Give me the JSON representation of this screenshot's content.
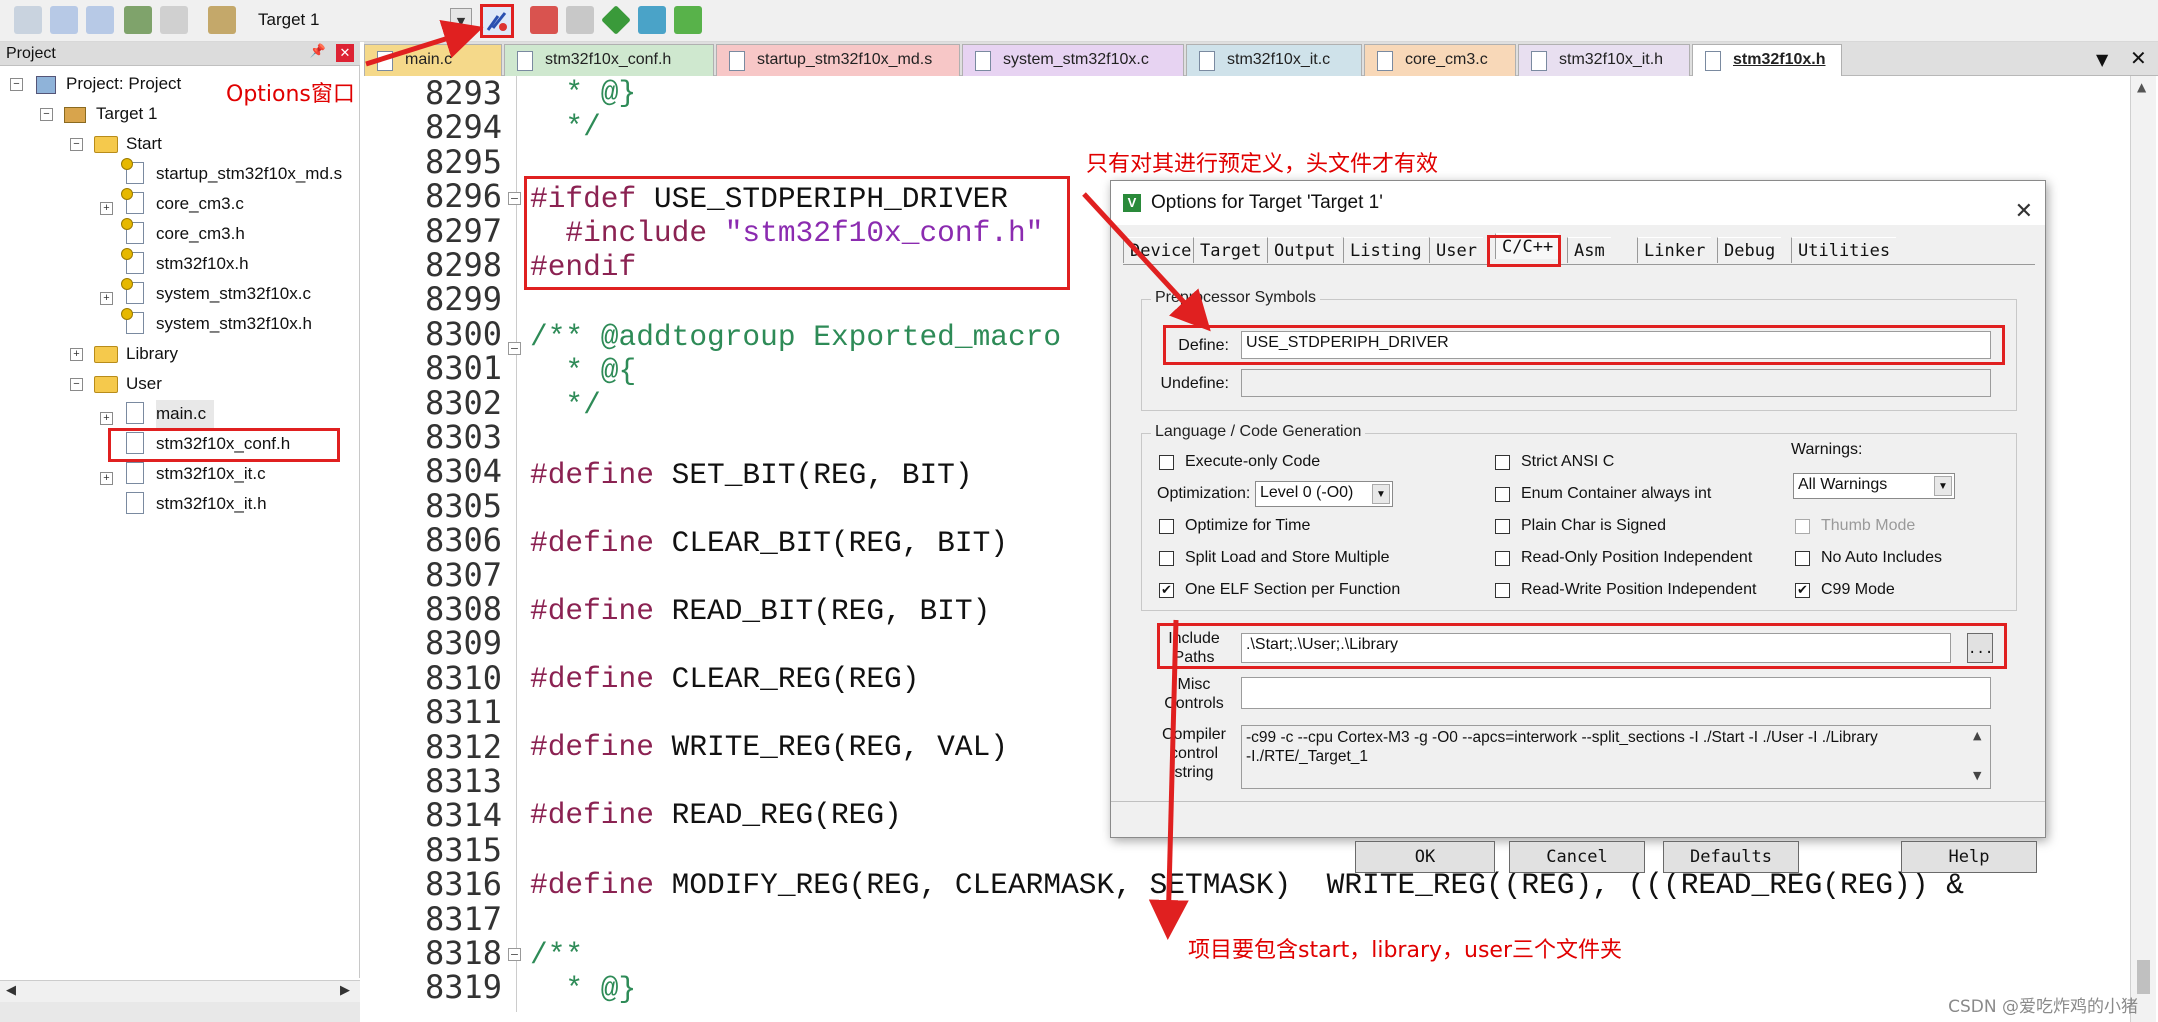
{
  "toolbar": {
    "target": "Target 1",
    "icons": [
      "translate-icon",
      "build-icon",
      "rebuild-icon",
      "batch-build-icon",
      "stop-build-icon",
      "download-icon",
      "options-for-target-icon",
      "manage-project-items-icon",
      "select-packs-icon",
      "manage-run-time-icon",
      "pack-installer-icon",
      "device-database-icon"
    ]
  },
  "project_panel": {
    "title": "Project",
    "tree": {
      "root": "Project: Project",
      "target": "Target 1",
      "start_group": "Start",
      "start_files": [
        "startup_stm32f10x_md.s",
        "core_cm3.c",
        "core_cm3.h",
        "stm32f10x.h",
        "system_stm32f10x.c",
        "system_stm32f10x.h"
      ],
      "library_group": "Library",
      "user_group": "User",
      "user_files": [
        "main.c",
        "stm32f10x_conf.h",
        "stm32f10x_it.c",
        "stm32f10x_it.h"
      ]
    }
  },
  "editor": {
    "tabs": [
      "main.c",
      "stm32f10x_conf.h",
      "startup_stm32f10x_md.s",
      "system_stm32f10x.c",
      "stm32f10x_it.c",
      "core_cm3.c",
      "stm32f10x_it.h",
      "stm32f10x.h"
    ],
    "tab_colors": [
      "#f5d98a",
      "#cfe8cf",
      "#f7c7c7",
      "#e7d3f2",
      "#cfe2ea",
      "#f8d8b8",
      "#e8dff0",
      "#ffffff"
    ],
    "active_tab": "stm32f10x.h",
    "line_numbers": [
      "8293",
      "8294",
      "8295",
      "8296",
      "8297",
      "8298",
      "8299",
      "8300",
      "8301",
      "8302",
      "8303",
      "8304",
      "8305",
      "8306",
      "8307",
      "8308",
      "8309",
      "8310",
      "8311",
      "8312",
      "8313",
      "8314",
      "8315",
      "8316",
      "8317",
      "8318",
      "8319"
    ],
    "code": {
      "l8293": "  * @}",
      "l8294": "  */",
      "l8296_kw": "#ifdef",
      "l8296_rest": " USE_STDPERIPH_DRIVER",
      "l8297_kw": "  #include",
      "l8297_str": " \"stm32f10x_conf.h\"",
      "l8298_kw": "#endif",
      "l8300": "/** @addtogroup Exported_macro",
      "l8301": "  * @{",
      "l8302": "  */",
      "l8304_kw": "#define",
      "l8304_rest": " SET_BIT(REG, BIT)",
      "l8306_kw": "#define",
      "l8306_rest": " CLEAR_BIT(REG, BIT)",
      "l8308_kw": "#define",
      "l8308_rest": " READ_BIT(REG, BIT)",
      "l8310_kw": "#define",
      "l8310_rest": " CLEAR_REG(REG)",
      "l8312_kw": "#define",
      "l8312_rest": " WRITE_REG(REG, VAL)",
      "l8314_kw": "#define",
      "l8314_rest": " READ_REG(REG)",
      "l8316_kw": "#define",
      "l8316_rest": " MODIFY_REG(REG, CLEARMASK, SETMASK)  WRITE_REG((REG), (((READ_REG(REG)) &",
      "l8318": "/**",
      "l8319": "  * @}"
    }
  },
  "dialog": {
    "title": "Options for Target 'Target 1'",
    "tabs": [
      "Device",
      "Target",
      "Output",
      "Listing",
      "User",
      "C/C++",
      "Asm",
      "Linker",
      "Debug",
      "Utilities"
    ],
    "active_tab": "C/C++",
    "preprocessor": {
      "group_label": "Preprocessor Symbols",
      "define_label": "Define:",
      "define_value": "USE_STDPERIPH_DRIVER",
      "undefine_label": "Undefine:",
      "undefine_value": ""
    },
    "language": {
      "group_label": "Language / Code Generation",
      "execute_only": {
        "label": "Execute-only Code",
        "checked": false
      },
      "optimization_label": "Optimization:",
      "optimization_value": "Level 0 (-O0)",
      "optimize_time": {
        "label": "Optimize for Time",
        "checked": false
      },
      "split_load": {
        "label": "Split Load and Store Multiple",
        "checked": false
      },
      "one_elf": {
        "label": "One ELF Section per Function",
        "checked": true
      },
      "strict_ansi": {
        "label": "Strict ANSI C",
        "checked": false
      },
      "enum_container": {
        "label": "Enum Container always int",
        "checked": false
      },
      "plain_char": {
        "label": "Plain Char is Signed",
        "checked": false
      },
      "ro_pi": {
        "label": "Read-Only Position Independent",
        "checked": false
      },
      "rw_pi": {
        "label": "Read-Write Position Independent",
        "checked": false
      },
      "warnings_label": "Warnings:",
      "warnings_value": "All Warnings",
      "thumb_mode": {
        "label": "Thumb Mode",
        "checked": false,
        "disabled": true
      },
      "no_auto_includes": {
        "label": "No Auto Includes",
        "checked": false
      },
      "c99_mode": {
        "label": "C99 Mode",
        "checked": true
      }
    },
    "include_paths": {
      "label_line1": "Include",
      "label_line2": "Paths",
      "value": ".\\Start;.\\User;.\\Library",
      "browse": "..."
    },
    "misc": {
      "label_line1": "Misc",
      "label_line2": "Controls",
      "value": ""
    },
    "compiler_string": {
      "label_line1": "Compiler",
      "label_line2": "control",
      "label_line3": "string",
      "line1": "-c99 -c --cpu Cortex-M3 -g -O0 --apcs=interwork --split_sections -I ./Start -I ./User -I ./Library",
      "line2": "-I./RTE/_Target_1"
    },
    "buttons": {
      "ok": "OK",
      "cancel": "Cancel",
      "defaults": "Defaults",
      "help": "Help"
    }
  },
  "annotations": {
    "options_window": "Options窗口",
    "predefine_note": "只有对其进行预定义，头文件才有效",
    "include_note": "项目要包含start，library，user三个文件夹",
    "highlight_color": "#e02020"
  },
  "watermark": "CSDN @爱吃炸鸡的小猪"
}
